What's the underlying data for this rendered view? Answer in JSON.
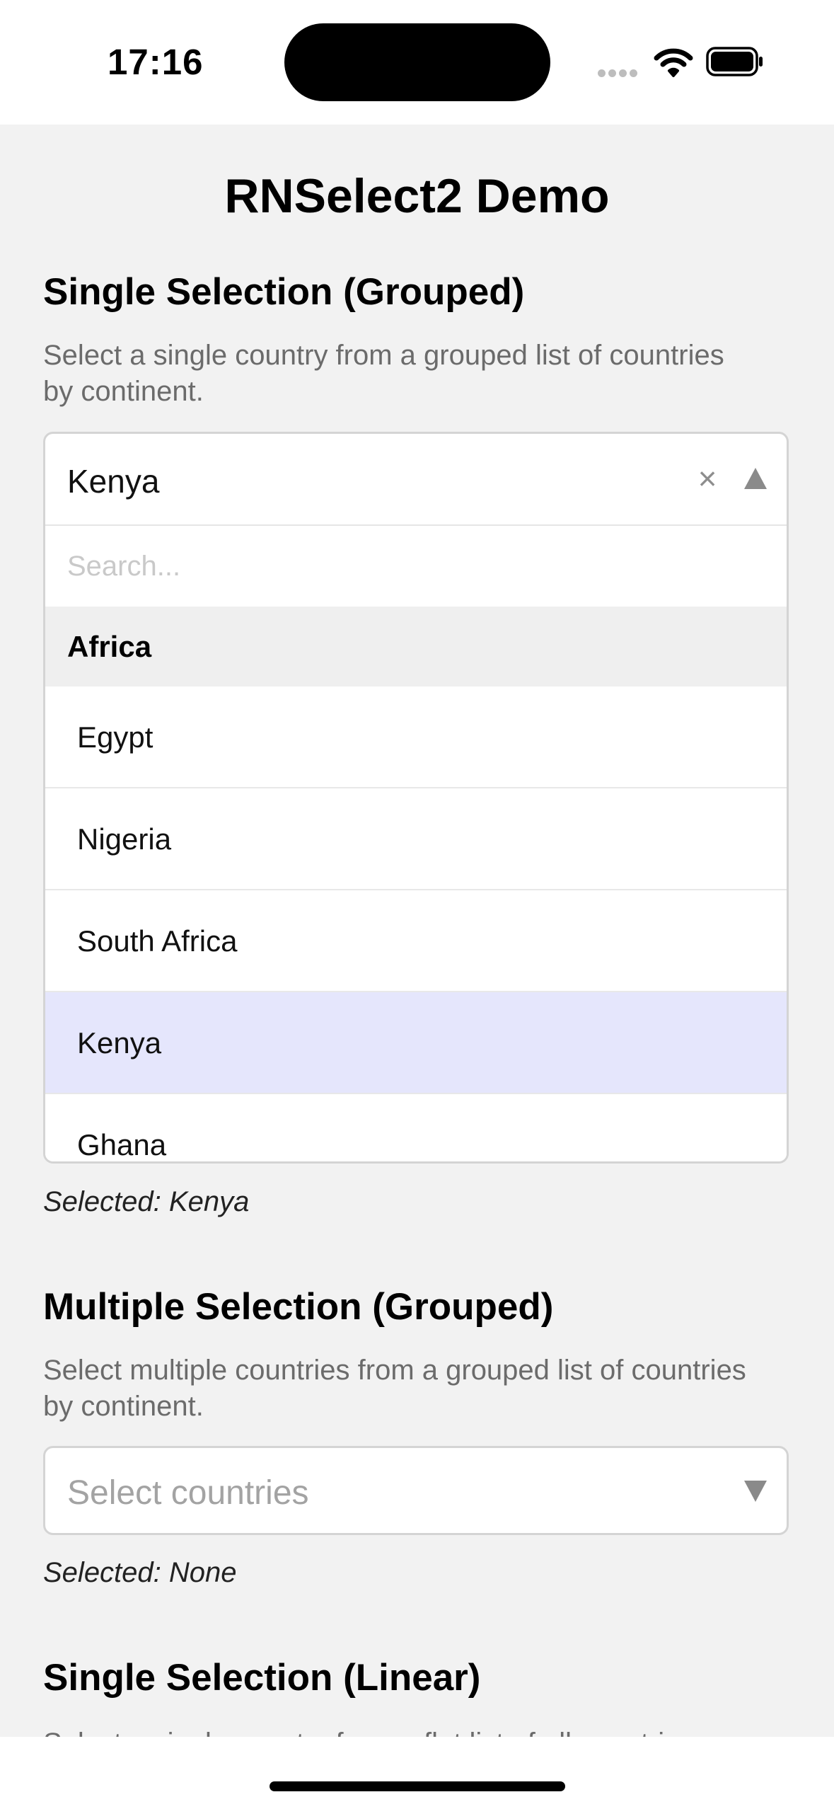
{
  "status_bar": {
    "time": "17:16",
    "icons": [
      "cellular-signal-icon",
      "wifi-icon",
      "battery-icon"
    ]
  },
  "page": {
    "title": "RNSelect2 Demo"
  },
  "single_grouped": {
    "title": "Single Selection (Grouped)",
    "description": "Select a single country from a grouped list of countries by continent.",
    "value": "Kenya",
    "clear_glyph": "×",
    "search_placeholder": "Search...",
    "group_label": "Africa",
    "options": [
      "Egypt",
      "Nigeria",
      "South Africa",
      "Kenya",
      "Ghana"
    ],
    "selected_option": "Kenya",
    "selected_text": "Selected: Kenya"
  },
  "multiple_grouped": {
    "title": "Multiple Selection (Grouped)",
    "description": "Select multiple countries from a grouped list of countries by continent.",
    "placeholder": "Select countries",
    "selected_text": "Selected: None"
  },
  "single_linear": {
    "title": "Single Selection (Linear)",
    "description": "Select a single country from a flat list of all countries"
  },
  "colors": {
    "page_background": "#f2f2f2",
    "selected_option_background": "#e5e6fc",
    "group_header_background": "#efefef",
    "border": "#d4d4d4"
  }
}
